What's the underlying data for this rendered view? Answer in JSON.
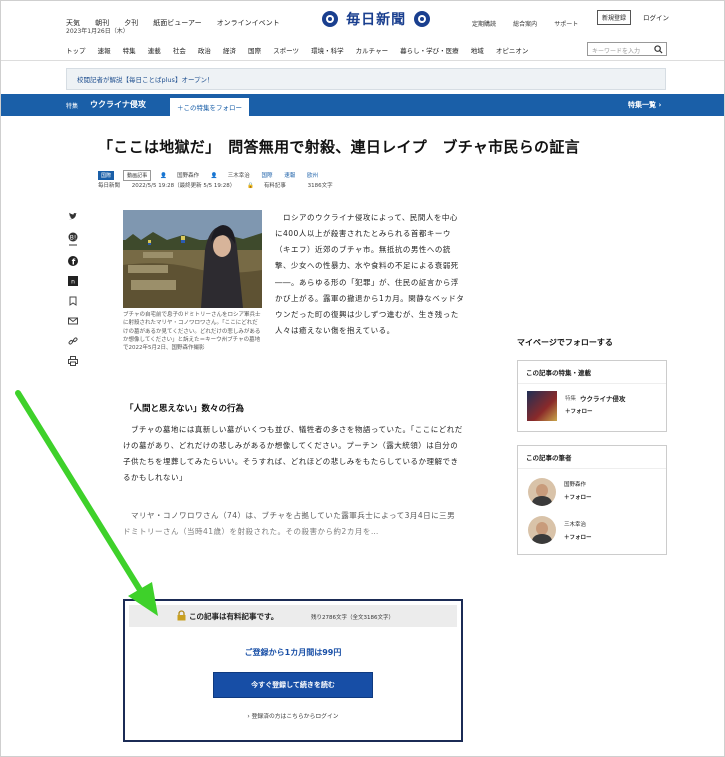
{
  "header": {
    "top_links": [
      "天気",
      "朝刊",
      "夕刊",
      "紙面ビューアー",
      "オンラインイベント"
    ],
    "date": "2023年1月26日（木）",
    "logo_text": "毎日新聞",
    "util_links": [
      "定期購読",
      "総合案内",
      "サポート"
    ],
    "register_label": "新規登録",
    "login_label": "ログイン",
    "nav_items": [
      "トップ",
      "速報",
      "特集",
      "連載",
      "社会",
      "政治",
      "経済",
      "国際",
      "スポーツ",
      "環境・科学",
      "カルチャー",
      "暮らし・学び・医療",
      "地域",
      "オピニオン"
    ],
    "search_placeholder": "キーワードを入力"
  },
  "notice": "校閲記者が解説【毎日ことばplus】オープン！",
  "feature_bar": {
    "label": "特集",
    "title": "ウクライナ侵攻",
    "follow_label": "＋この特集をフォロー",
    "list_label": "特集一覧"
  },
  "article": {
    "title": "「ここは地獄だ」　問答無用で射殺、連日レイプ　ブチャ市民らの証言",
    "tags": [
      "国際",
      "動画記事"
    ],
    "authors": [
      "国野森作",
      "三木幸治"
    ],
    "categories": [
      "国際",
      "速報",
      "欧州"
    ],
    "source": "毎日新聞",
    "date": "2022/5/5 19:28（最終更新 5/5 19:28）",
    "paid_label": "有料記事",
    "char_count": "3186文字",
    "caption": "ブチャの自宅前で息子のドミトリーさんをロシア軍兵士に射殺されたマリヤ・コノワロワさん。「ここにどれだけの墓があるか見てください。どれだけの悲しみがあるか想像してください」と訴えた＝キーウ州ブチャの墓地で2022年5月2日、国野森作撮影",
    "lead": "　ロシアのウクライナ侵攻によって、民間人を中心に400人以上が殺害されたとみられる首都キーウ（キエフ）近郊のブチャ市。無抵抗の男性への銃撃、少女への性暴力、水や食料の不足による衰弱死――。あらゆる形の「犯罪」が、住民の証言から浮かび上がる。露軍の撤退から1カ月。閑静なベッドタウンだった町の復興は少しずつ進むが、生き残った人々は癒えない傷を抱えている。",
    "subhead": "「人間と思えない」数々の行為",
    "para1": "　ブチャの墓地には真新しい墓がいくつも並び、犠牲者の多さを物語っていた。「ここにどれだけの墓があり、どれだけの悲しみがあるか想像してください。プーチン（露大統領）は自分の子供たちを埋葬してみたらいい。そうすれば、どれほどの悲しみをもたらしているか理解できるかもしれない」",
    "para2": "　マリヤ・コノワロワさん（74）は、ブチャを占拠していた露軍兵士によって3月4日に三男ドミトリーさん（当時41歳）を射殺された。その殺害から約2カ月を…"
  },
  "sidebar": {
    "mypage_title": "マイページでフォローする",
    "feature_box_title": "この記事の特集・連載",
    "feature_small": "特集",
    "feature_name": "ウクライナ侵攻",
    "follow": "＋フォロー",
    "writers_title": "この記事の筆者",
    "writer1": "国野森作",
    "writer2": "三木幸治"
  },
  "paywall": {
    "title": "この記事は有料記事です。",
    "remaining": "残り2786文字（全文3186文字）",
    "offer": "ご登録から1カ月間は99円",
    "cta": "今すぐ登録して続きを読む",
    "login_link": "登録済の方はこちらからログイン"
  },
  "colors": {
    "brand_blue": "#1a5fa8",
    "cta_blue": "#174ea6",
    "arrow_green": "#3ed12a"
  },
  "icons": [
    "twitter-icon",
    "hatena-icon",
    "facebook-icon",
    "note-icon",
    "bookmark-icon",
    "mail-icon",
    "link-icon",
    "print-icon",
    "lock-icon",
    "chevron-right-icon"
  ]
}
